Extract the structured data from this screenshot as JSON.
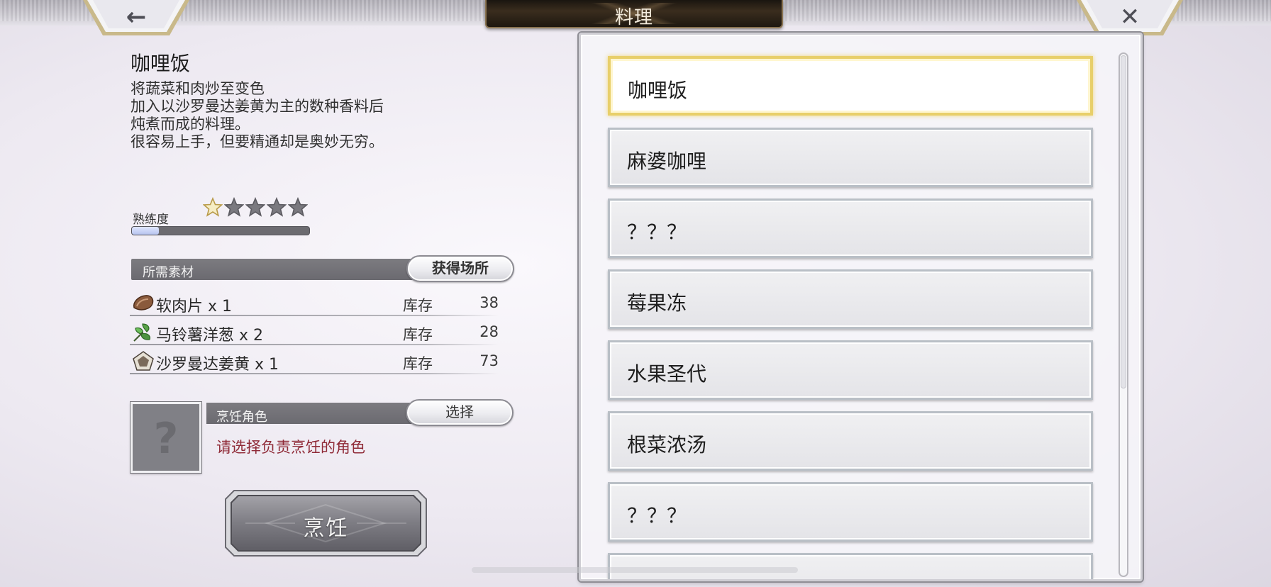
{
  "header": {
    "title": "料理",
    "back_icon": "←",
    "close_icon": "✕"
  },
  "detail": {
    "dish_name": "咖哩饭",
    "description": [
      "将蔬菜和肉炒至变色",
      "加入以沙罗曼达姜黄为主的数种香料后",
      "炖煮而成的料理。",
      "很容易上手，但要精通却是奥妙无穷。"
    ],
    "proficiency_label": "熟练度",
    "proficiency_stars": 1,
    "proficiency_max_stars": 5,
    "proficiency_fraction": 0.15
  },
  "materials": {
    "header_label": "所需素材",
    "obtain_button": "获得场所",
    "stock_label": "库存",
    "items": [
      {
        "name": "软肉片 x 1",
        "stock": "38",
        "icon": "meat-icon"
      },
      {
        "name": "马铃薯洋葱 x 2",
        "stock": "28",
        "icon": "herb-icon"
      },
      {
        "name": "沙罗曼达姜黄 x 1",
        "stock": "73",
        "icon": "spice-icon"
      }
    ]
  },
  "chef": {
    "header_label": "烹饪角色",
    "select_button": "选择",
    "placeholder_glyph": "?",
    "hint": "请选择负责烹饪的角色"
  },
  "cook_button": "烹饪",
  "recipes": [
    {
      "label": "咖哩饭",
      "selected": true
    },
    {
      "label": "麻婆咖哩",
      "selected": false
    },
    {
      "label": "？？？",
      "selected": false
    },
    {
      "label": "莓果冻",
      "selected": false
    },
    {
      "label": "水果圣代",
      "selected": false
    },
    {
      "label": "根菜浓汤",
      "selected": false
    },
    {
      "label": "？？？",
      "selected": false
    },
    {
      "label": "",
      "selected": false
    }
  ],
  "colors": {
    "selected_border": "#e8cf6a",
    "hint_text": "#8f2a37",
    "title_plate": "#2a2117"
  }
}
